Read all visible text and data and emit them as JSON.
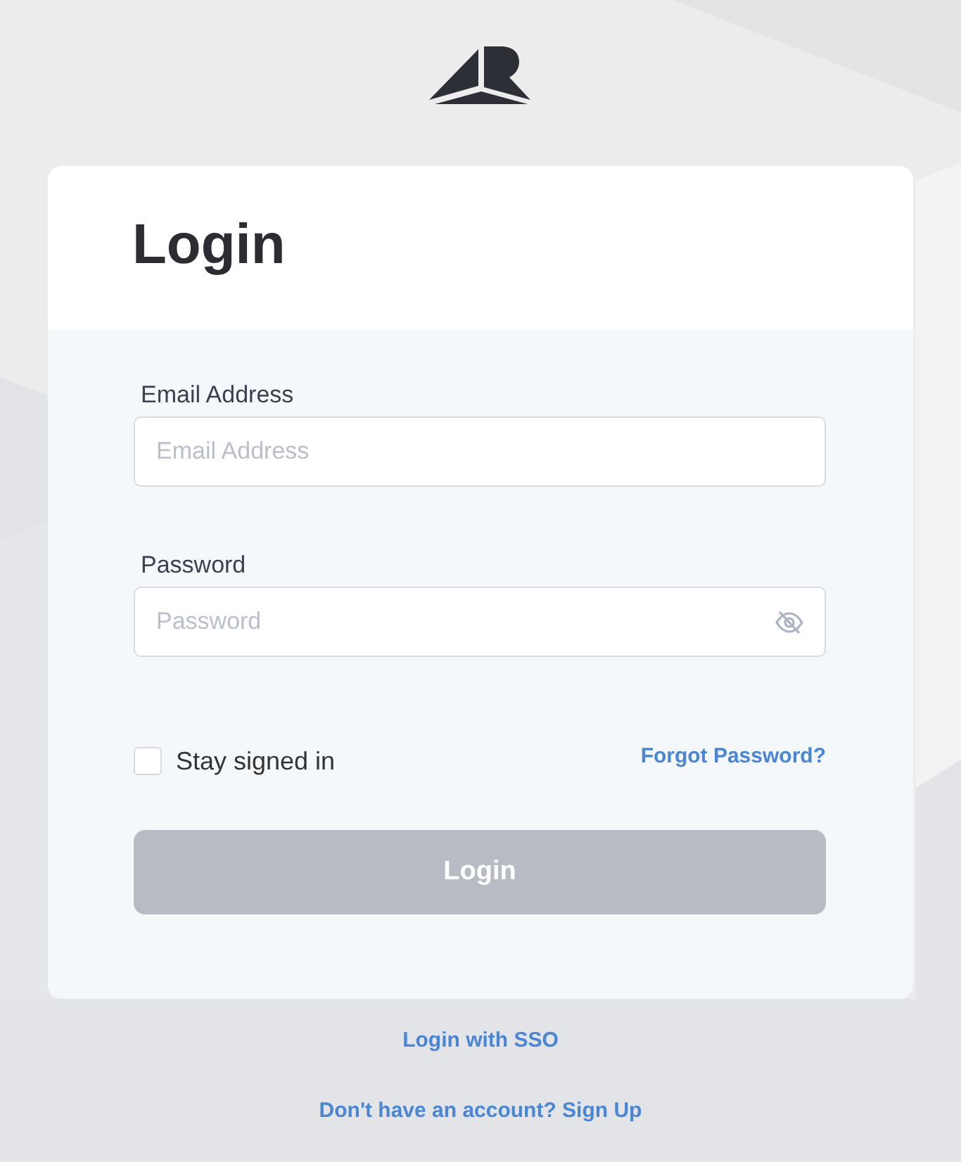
{
  "card": {
    "title": "Login"
  },
  "fields": [
    {
      "kind": "email",
      "label": "Email Address",
      "placeholder": "Email Address"
    },
    {
      "kind": "password",
      "label": "Password",
      "placeholder": "Password"
    }
  ],
  "stay_signed_in": {
    "label": "Stay signed in",
    "checked": false
  },
  "forgot_password": "Forgot Password?",
  "submit": {
    "label": "Login",
    "disabled": true
  },
  "links": [
    "Login with SSO",
    "Don't have an account? Sign Up"
  ]
}
